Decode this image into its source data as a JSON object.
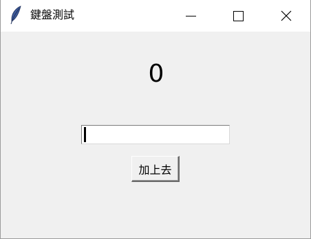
{
  "window": {
    "title": "鍵盤測試",
    "icon": "feather-icon",
    "controls": {
      "minimize": "minimize-icon",
      "maximize": "maximize-icon",
      "close": "close-icon"
    }
  },
  "main": {
    "counter_value": "0",
    "entry": {
      "value": ""
    },
    "add_button_label": "加上去"
  },
  "colors": {
    "titlebar": "#ffffff",
    "background": "#f0f0f0",
    "text": "#000000",
    "feather": "#3f5b9a"
  }
}
